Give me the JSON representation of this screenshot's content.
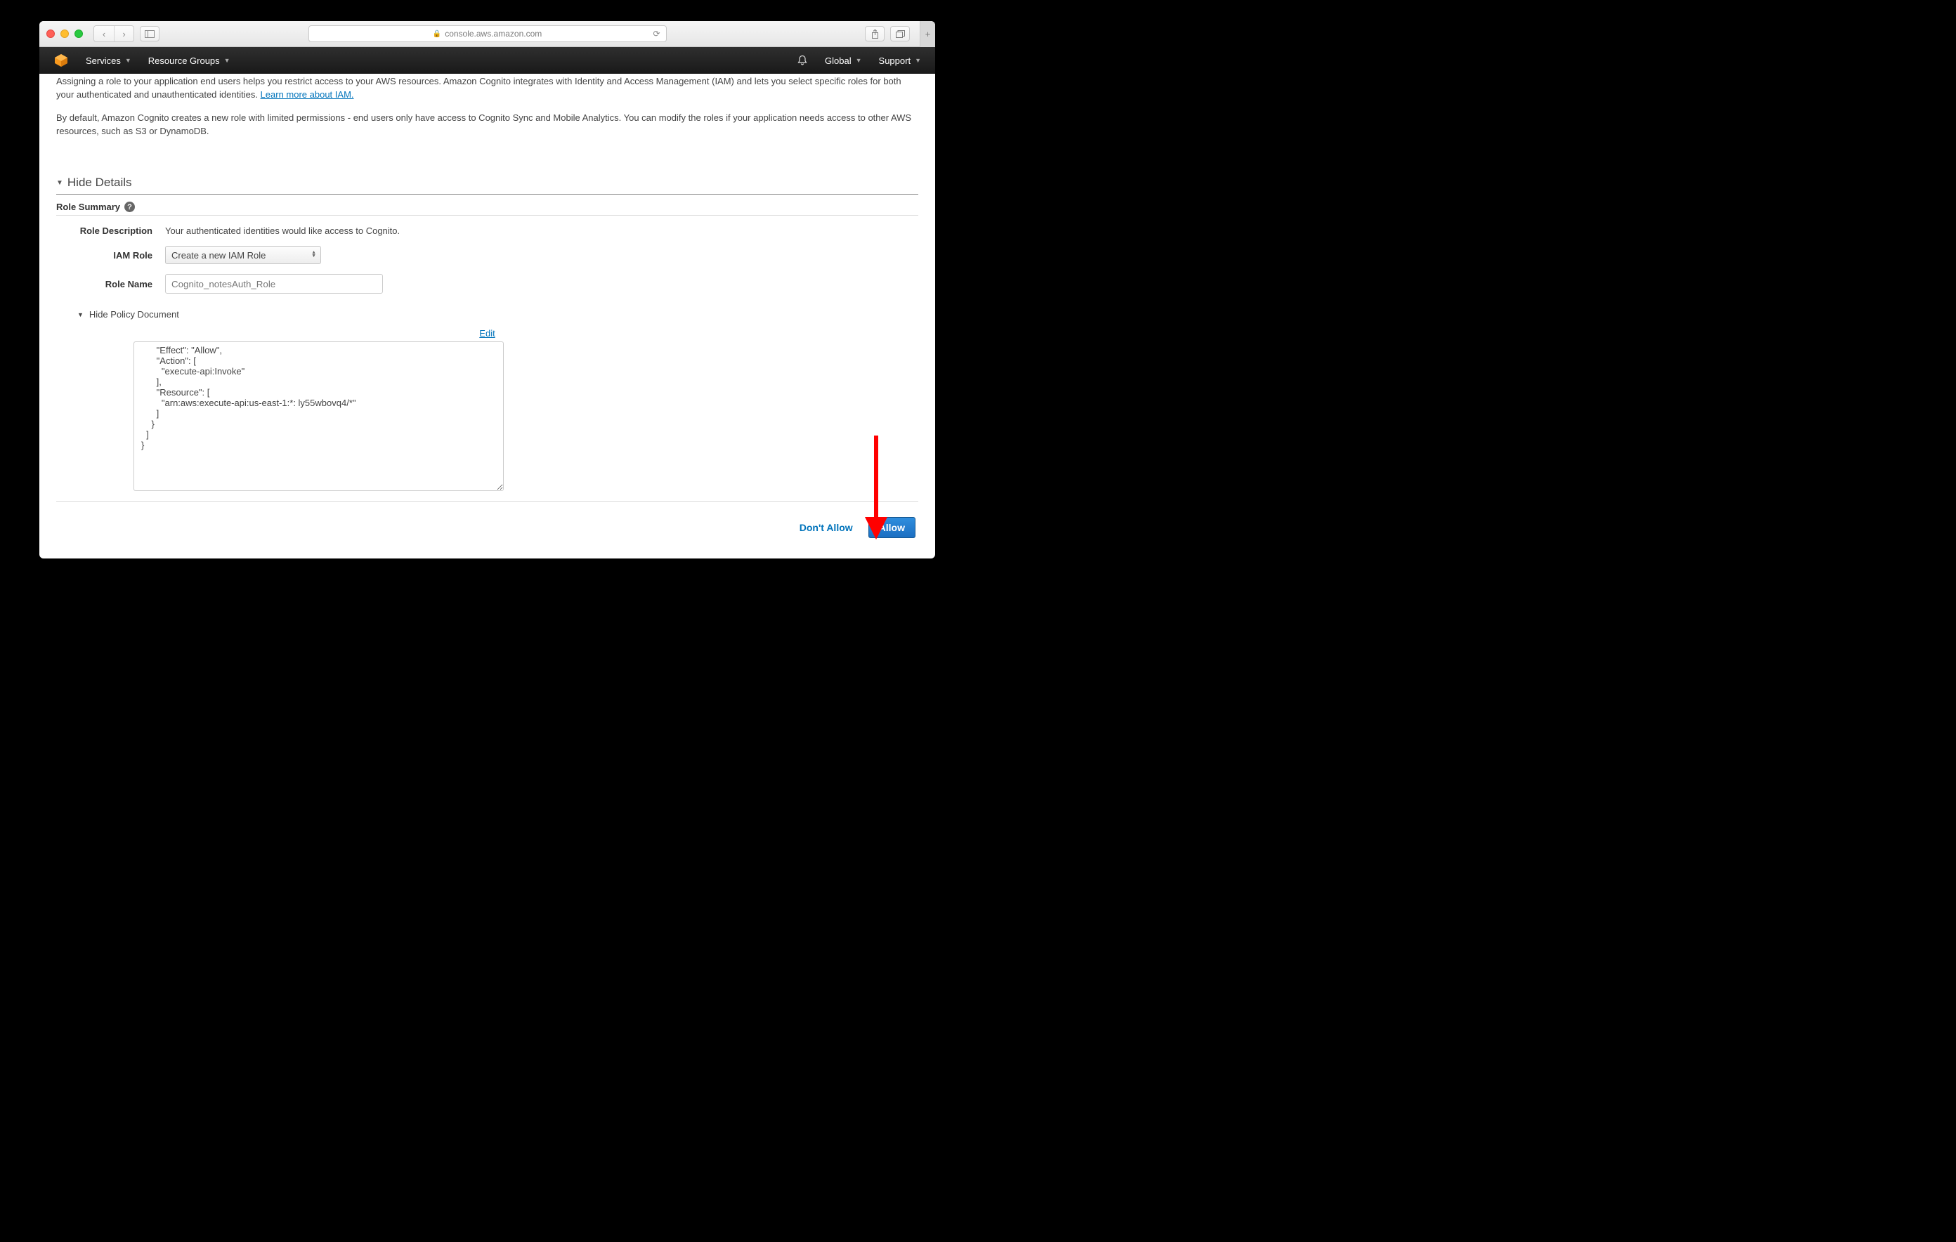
{
  "browser": {
    "url": "console.aws.amazon.com"
  },
  "awsNav": {
    "services": "Services",
    "resourceGroups": "Resource Groups",
    "region": "Global",
    "support": "Support"
  },
  "intro": {
    "line1": "Assigning a role to your application end users helps you restrict access to your AWS resources. Amazon Cognito integrates with Identity and Access Management (IAM) and lets you select specific roles for both your authenticated and unauthenticated identities.  ",
    "learnMore": "Learn more about IAM.",
    "line2": "By default, Amazon Cognito creates a new role with limited permissions - end users only have access to Cognito Sync and Mobile Analytics. You can modify the roles if your application needs access to other AWS resources, such as S3 or DynamoDB."
  },
  "details": {
    "toggleLabel": "Hide Details",
    "roleSummary": "Role Summary",
    "fields": {
      "roleDescriptionLabel": "Role Description",
      "roleDescriptionValue": "Your authenticated identities would like access to Cognito.",
      "iamRoleLabel": "IAM Role",
      "iamRoleValue": "Create a new IAM Role",
      "roleNameLabel": "Role Name",
      "roleNameValue": "Cognito_notesAuth_Role"
    },
    "policyToggle": "Hide Policy Document",
    "editLabel": "Edit",
    "policyDocument": "      \"Effect\": \"Allow\",\n      \"Action\": [\n        \"execute-api:Invoke\"\n      ],\n      \"Resource\": [\n        \"arn:aws:execute-api:us-east-1:*: ly55wbovq4/*\"\n      ]\n    }\n  ]\n}"
  },
  "footer": {
    "dontAllow": "Don't Allow",
    "allow": "Allow"
  }
}
